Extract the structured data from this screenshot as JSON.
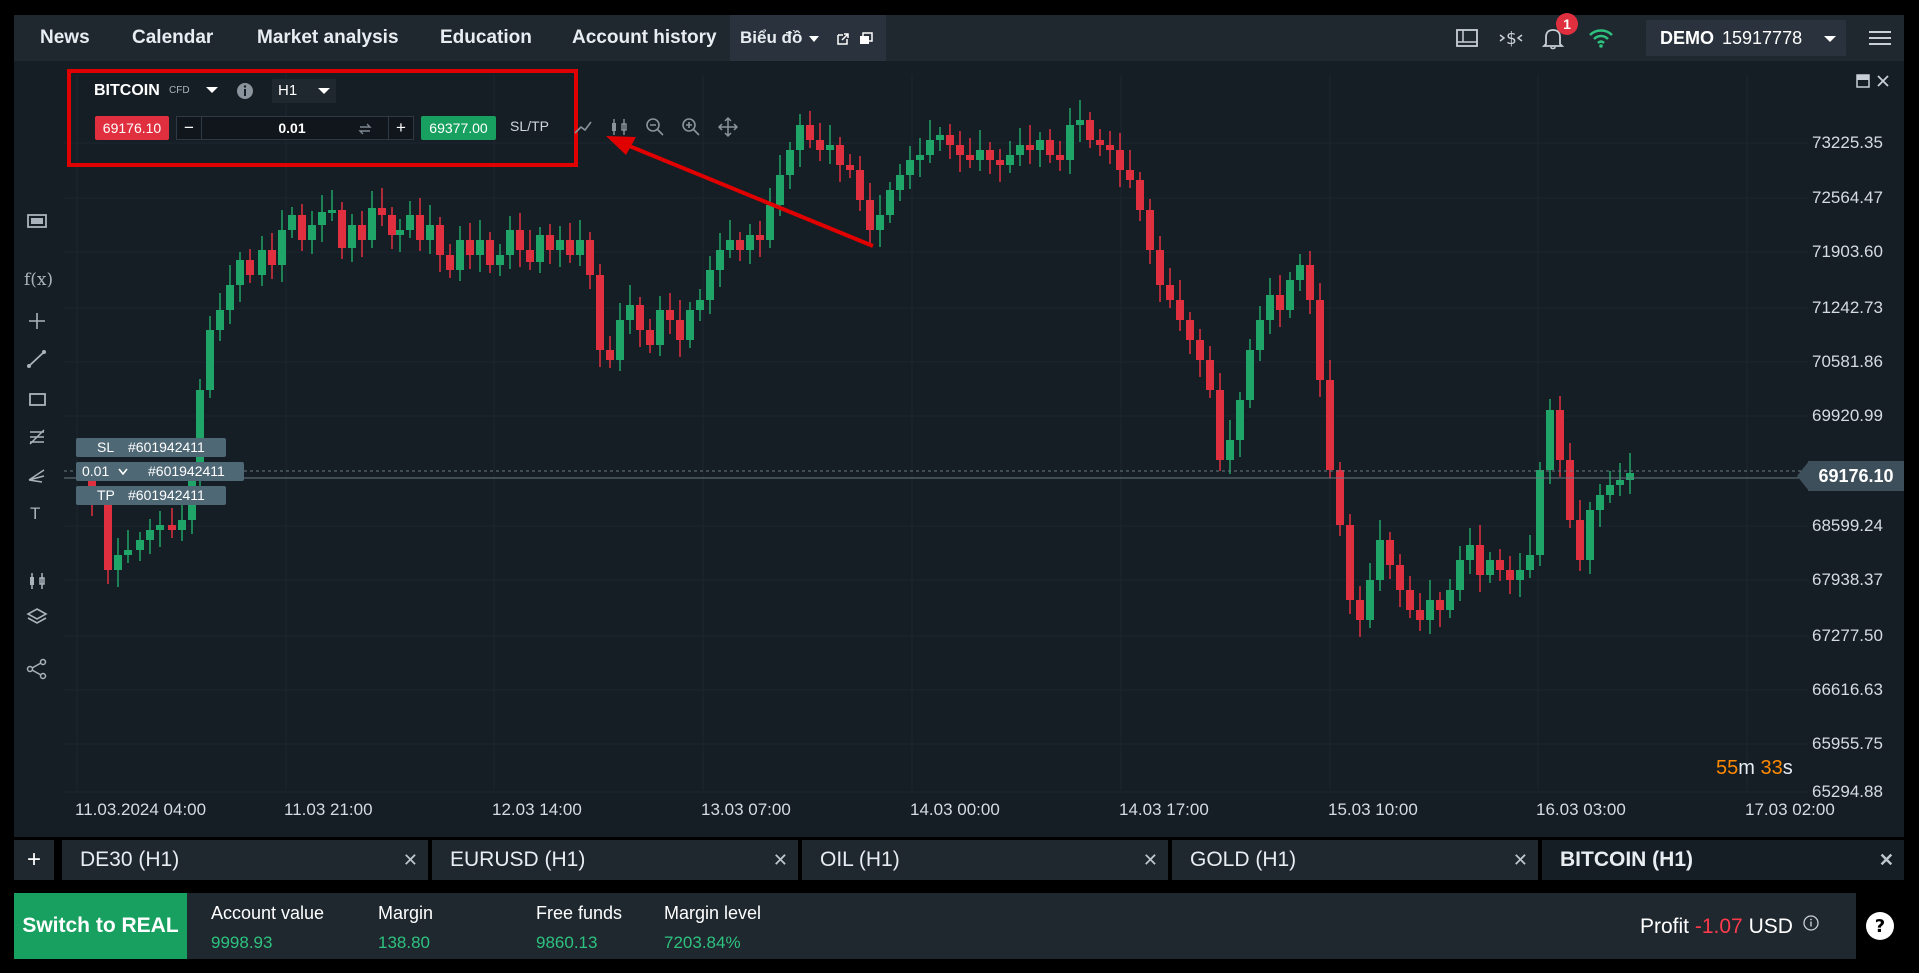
{
  "topbar": {
    "tabs": [
      "News",
      "Calendar",
      "Market analysis",
      "Education",
      "Account history"
    ],
    "active_tab": "Biểu đồ",
    "notification_count": "1",
    "account_type": "DEMO",
    "account_number": "15917778"
  },
  "instrument": {
    "symbol": "BITCOIN",
    "kind": "CFD",
    "timeframe": "H1",
    "sell_price": "69176.10",
    "buy_price": "69377.00",
    "quantity": "0.01",
    "minus": "−",
    "plus": "+",
    "sltp_label": "SL/TP"
  },
  "chart": {
    "y_axis_labels": [
      "73225.35",
      "72564.47",
      "71903.60",
      "71242.73",
      "70581.86",
      "69920.99",
      "68599.24",
      "67938.37",
      "67277.50",
      "66616.63",
      "65955.75",
      "65294.88"
    ],
    "x_axis_labels": [
      "11.03.2024 04:00",
      "11.03 21:00",
      "12.03 14:00",
      "13.03 07:00",
      "14.03 00:00",
      "14.03 17:00",
      "15.03 10:00",
      "16.03 03:00",
      "17.03 02:00"
    ],
    "current_price": "69176.10",
    "timer_min": "55",
    "timer_min_unit": "m",
    "timer_sec": "33",
    "timer_sec_unit": "s",
    "orders": {
      "sl_label": "SL",
      "tp_label": "TP",
      "qty_label": "0.01",
      "order_id": "#601942411"
    }
  },
  "bottom_tabs": [
    "DE30 (H1)",
    "EURUSD (H1)",
    "OIL (H1)",
    "GOLD (H1)",
    "BITCOIN (H1)"
  ],
  "footer": {
    "switch_label": "Switch to REAL",
    "stats": [
      {
        "label": "Account value",
        "value": "9998.93"
      },
      {
        "label": "Margin",
        "value": "138.80"
      },
      {
        "label": "Free funds",
        "value": "9860.13"
      },
      {
        "label": "Margin level",
        "value": "7203.84%"
      }
    ],
    "profit_label": "Profit",
    "profit_value": "-1.07",
    "profit_currency": "USD"
  },
  "colors": {
    "bull": "#1fa567",
    "bear": "#e0303f",
    "annotation": "#e00000"
  }
}
